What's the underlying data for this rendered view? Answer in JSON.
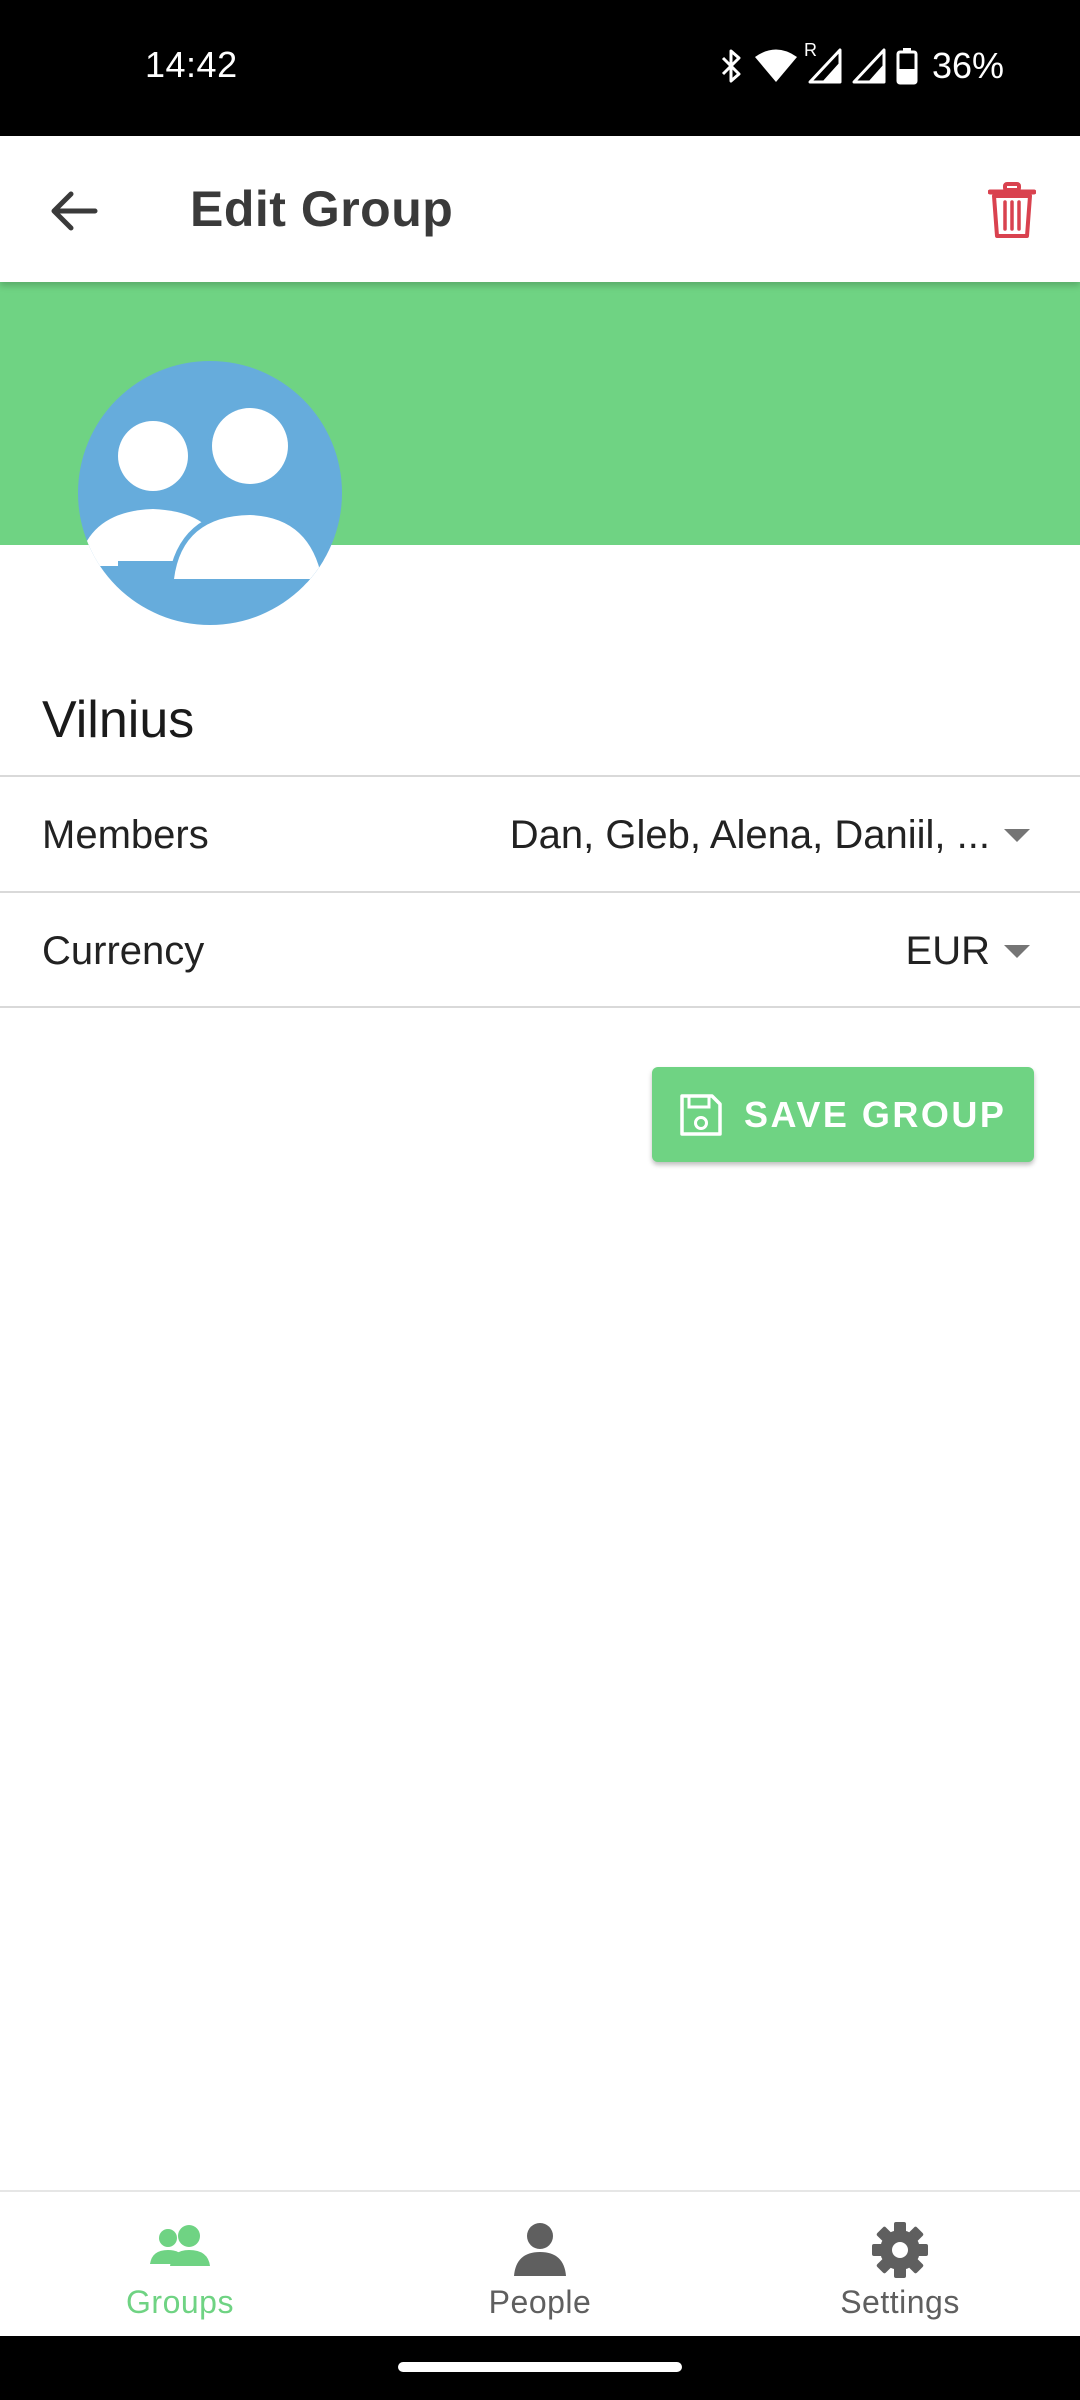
{
  "status_bar": {
    "time": "14:42",
    "battery_percent": "36%",
    "roaming_indicator": "R",
    "icons": [
      "bluetooth-icon",
      "wifi-icon",
      "cell-signal-icon",
      "cell-signal-icon",
      "battery-icon"
    ]
  },
  "app_bar": {
    "title": "Edit Group",
    "back_icon": "arrow-left-icon",
    "delete_icon": "trash-icon"
  },
  "group": {
    "name": "Vilnius",
    "avatar_icon": "group-avatar-icon"
  },
  "fields": {
    "members": {
      "label": "Members",
      "value": "Dan, Gleb, Alena, Daniil, ..."
    },
    "currency": {
      "label": "Currency",
      "value": "EUR"
    }
  },
  "save_button": {
    "label": "SAVE GROUP",
    "icon": "floppy-disk-icon"
  },
  "bottom_nav": {
    "items": [
      {
        "label": "Groups",
        "icon": "groups-icon",
        "active": true
      },
      {
        "label": "People",
        "icon": "person-icon",
        "active": false
      },
      {
        "label": "Settings",
        "icon": "gear-icon",
        "active": false
      }
    ]
  },
  "colors": {
    "accent_green": "#6fd383",
    "avatar_blue": "#66acdc",
    "delete_red": "#d9424f",
    "inactive_gray": "#5f5f5f"
  }
}
